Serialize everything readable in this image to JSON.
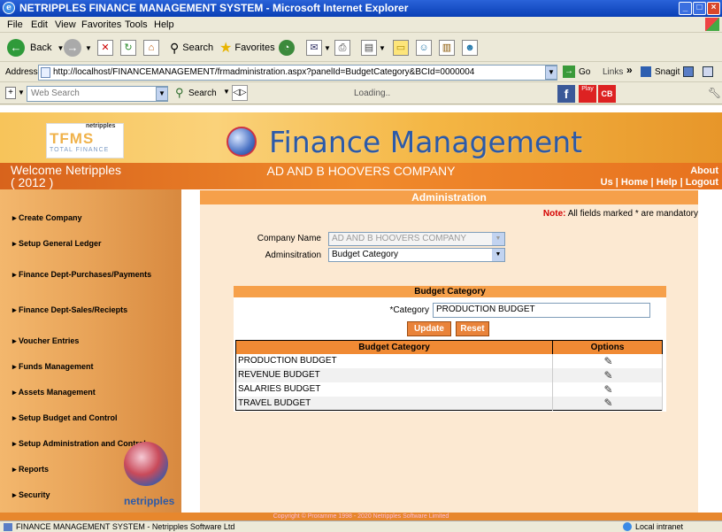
{
  "window": {
    "title": "NETRIPPLES FINANCE MANAGEMENT SYSTEM - Microsoft Internet Explorer",
    "min": "_",
    "max": "□",
    "close": "×"
  },
  "menu": [
    "File",
    "Edit",
    "View",
    "Favorites",
    "Tools",
    "Help"
  ],
  "toolbar": {
    "back": "Back",
    "search": "Search",
    "favorites": "Favorites"
  },
  "address": {
    "label": "Address",
    "url": "http://localhost/FINANCEMANAGEMENT/frmadministration.aspx?panelId=BudgetCategory&BCId=0000004",
    "go": "Go",
    "links": "Links",
    "snagit": "Snagit"
  },
  "searchbar": {
    "placeholder": "Web Search",
    "search": "Search",
    "loading": "Loading.."
  },
  "banner": {
    "logo_text": "TFMS",
    "logo_sub": "TOTAL FINANCE",
    "logo_brand": "netripples",
    "title": "Finance Management"
  },
  "welcome": {
    "line1": "Welcome  Netripples",
    "line2": "( 2012 )",
    "company": "AD AND B HOOVERS COMPANY",
    "links": [
      "About",
      "Us",
      "Home",
      "Help",
      "Logout"
    ]
  },
  "sidebar": {
    "items": [
      "Create Company",
      "Setup General Ledger",
      "Finance Dept-Purchases/Payments",
      "Finance Dept-Sales/Reciepts",
      "Voucher Entries",
      "Funds Management",
      "Assets Management",
      "Setup Budget and Control",
      "Setup Administration and Control",
      "Reports",
      "Security"
    ],
    "brand": "netripples"
  },
  "admin": {
    "heading": "Administration",
    "note_label": "Note:",
    "note_text": "All fields marked * are mandatory",
    "company_label": "Company Name",
    "company_value": "AD AND B HOOVERS COMPANY",
    "admin_label": "Adminsitration",
    "admin_value": "Budget Category"
  },
  "budget": {
    "heading": "Budget Category",
    "category_label": "*Category",
    "category_value": "PRODUCTION BUDGET",
    "update": "Update",
    "reset": "Reset",
    "columns": [
      "Budget Category",
      "Options"
    ],
    "rows": [
      "PRODUCTION BUDGET",
      "REVENUE BUDGET",
      "SALARIES BUDGET",
      "TRAVEL BUDGET"
    ]
  },
  "footer": "Copyright © Proramme 1998 - 2020 Netripples Software Limited",
  "status": {
    "left": "FINANCE MANAGEMENT SYSTEM - Netripples Software Ltd",
    "right": "Local intranet"
  }
}
